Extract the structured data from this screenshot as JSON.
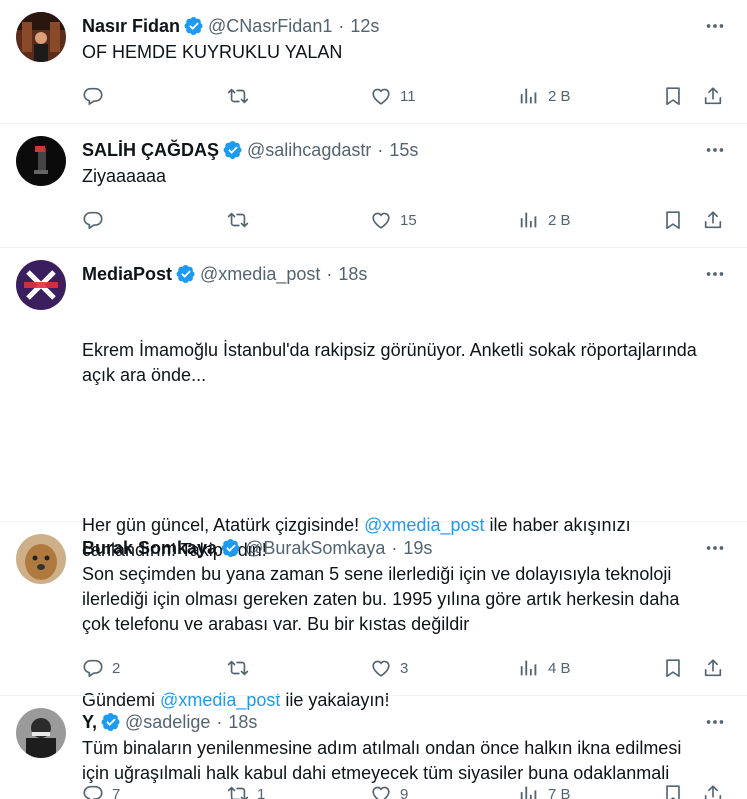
{
  "tweets": [
    {
      "name": "Nasır Fidan",
      "handle": "@CNasrFidan1",
      "time": "12s",
      "text": "OF HEMDE KUYRUKLU YALAN",
      "replies": "",
      "retweets": "",
      "likes": "11",
      "views": "2 B"
    },
    {
      "name": "SALİH ÇAĞDAŞ",
      "handle": "@salihcagdastr",
      "time": "15s",
      "text": "Ziyaaaaaa",
      "replies": "",
      "retweets": "",
      "likes": "15",
      "views": "2 B"
    },
    {
      "name": "MediaPost",
      "handle": "@xmedia_post",
      "time": "18s",
      "text_line1": "Ekrem İmamoğlu İstanbul'da rakipsiz görünüyor. Anketli sokak röportajlarında açık ara önde...",
      "text_line2_pre": "Her gün güncel, Atatürk çizgisinde! ",
      "text_line2_link": "@xmedia_post",
      "text_line2_post": " ile haber akışınızı canlandırın! Takip edin!",
      "text_line3_pre": "Gündemi ",
      "text_line3_link": "@xmedia_post",
      "text_line3_post": " ile yakalayın!",
      "replies": "7",
      "retweets": "1",
      "likes": "9",
      "views": "7 B"
    },
    {
      "name": "Burak Somkaya",
      "handle": "@BurakSomkaya",
      "time": "19s",
      "text": "Son seçimden bu yana zaman 5 sene ilerlediği için ve dolayısıyla teknoloji ilerlediği için olması gereken zaten bu. 1995 yılına göre artık herkesin daha çok telefonu ve arabası var. Bu bir kıstas değildir",
      "replies": "2",
      "retweets": "",
      "likes": "3",
      "views": "4 B"
    },
    {
      "name": "Y,",
      "handle": "@sadelige",
      "time": "18s",
      "text": "Tüm binaların yenilenmesine adım atılmalı ondan önce halkın ikna edilmesi için uğraşılmali halk kabul dahi etmeyecek tüm siyasiler buna odaklanmali"
    }
  ],
  "colors": {
    "accent": "#1d9bf0",
    "muted": "#536471",
    "text": "#0f1419",
    "divider": "#eff3f4"
  },
  "icons": [
    "verified-badge-icon",
    "more-icon",
    "reply-icon",
    "retweet-icon",
    "like-icon",
    "views-icon",
    "bookmark-icon",
    "share-icon"
  ]
}
